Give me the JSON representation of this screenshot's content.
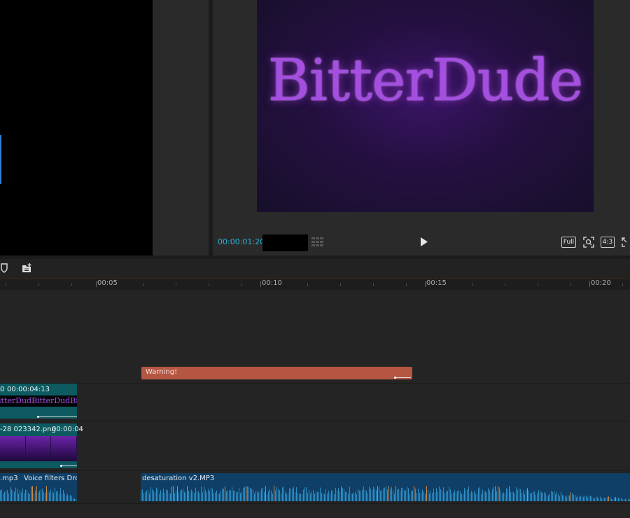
{
  "preview": {
    "logo_text": "BitterDude",
    "timecode": "00:00:01:20",
    "buttons": {
      "full": "Full",
      "ratio": "4:3"
    }
  },
  "ruler": {
    "labels": [
      "00:05",
      "00:10",
      "00:15",
      "00:20"
    ]
  },
  "tracks": {
    "warning_clip": {
      "label": "Warning!"
    },
    "title_clip": {
      "lead": "0",
      "time": "00:00:04:13",
      "strip_text": "itterDudBitterDudBitterDu"
    },
    "image_clip": {
      "name": "-28 023342.png",
      "time": "00:00:04"
    },
    "audio_clip_1": {
      "label": ".mp3",
      "effect": "Voice filters Drov"
    },
    "audio_clip_2": {
      "label": "desaturation v2.MP3"
    }
  },
  "colors": {
    "accent_timecode": "#27b4d9",
    "warning": "#b55643",
    "clip_teal": "#0d5a60",
    "audio_blue": "#0f3f66",
    "logo_purple": "#a44fe0"
  },
  "icons": [
    "shield-icon",
    "add-folder-icon",
    "grid-icon",
    "play-icon",
    "fit-screen-icon",
    "fullscreen-icon"
  ]
}
